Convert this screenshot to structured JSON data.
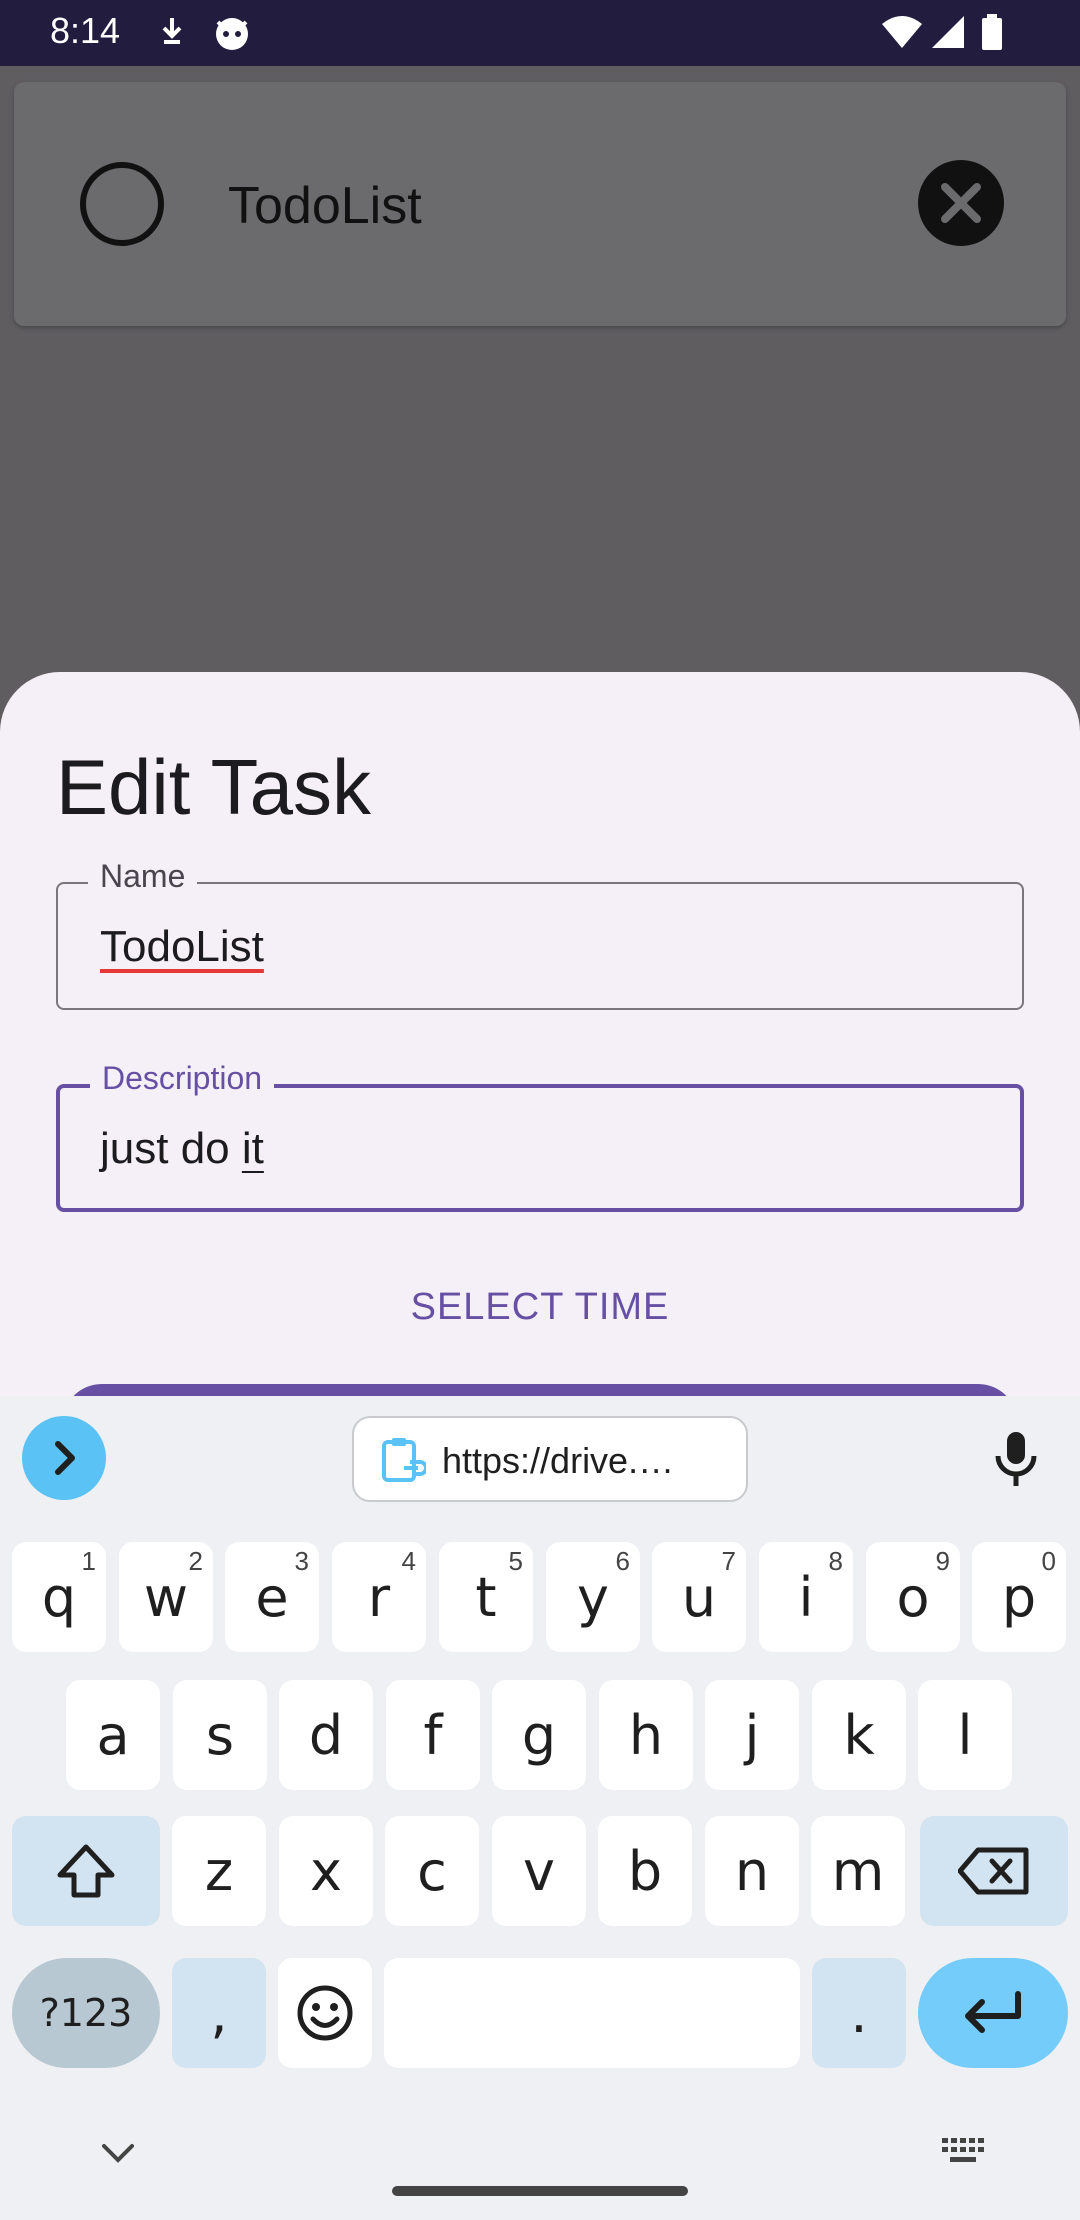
{
  "status_bar": {
    "time": "8:14",
    "icons": [
      "download-icon",
      "cat-icon",
      "wifi-icon",
      "signal-icon",
      "battery-icon"
    ]
  },
  "task_card": {
    "title": "TodoList"
  },
  "sheet": {
    "title": "Edit Task",
    "name_field": {
      "label": "Name",
      "value": "TodoList"
    },
    "description_field": {
      "label": "Description",
      "value_plain": "just do ",
      "value_composing": "it"
    },
    "select_time_label": "SELECT TIME"
  },
  "keyboard": {
    "clipboard_suggestion": "https://drive.…",
    "row1": [
      {
        "key": "q",
        "hint": "1"
      },
      {
        "key": "w",
        "hint": "2"
      },
      {
        "key": "e",
        "hint": "3"
      },
      {
        "key": "r",
        "hint": "4"
      },
      {
        "key": "t",
        "hint": "5"
      },
      {
        "key": "y",
        "hint": "6"
      },
      {
        "key": "u",
        "hint": "7"
      },
      {
        "key": "i",
        "hint": "8"
      },
      {
        "key": "o",
        "hint": "9"
      },
      {
        "key": "p",
        "hint": "0"
      }
    ],
    "row2": [
      "a",
      "s",
      "d",
      "f",
      "g",
      "h",
      "j",
      "k",
      "l"
    ],
    "row3": [
      "z",
      "x",
      "c",
      "v",
      "b",
      "n",
      "m"
    ],
    "symbols_key": "?123",
    "comma_key": ",",
    "period_key": "."
  },
  "colors": {
    "accent": "#6750a4",
    "status_bar": "#221c3f",
    "scrim": "#5f5d60",
    "sheet_bg": "#f5eff7",
    "keyboard_accent": "#74ccfa"
  }
}
